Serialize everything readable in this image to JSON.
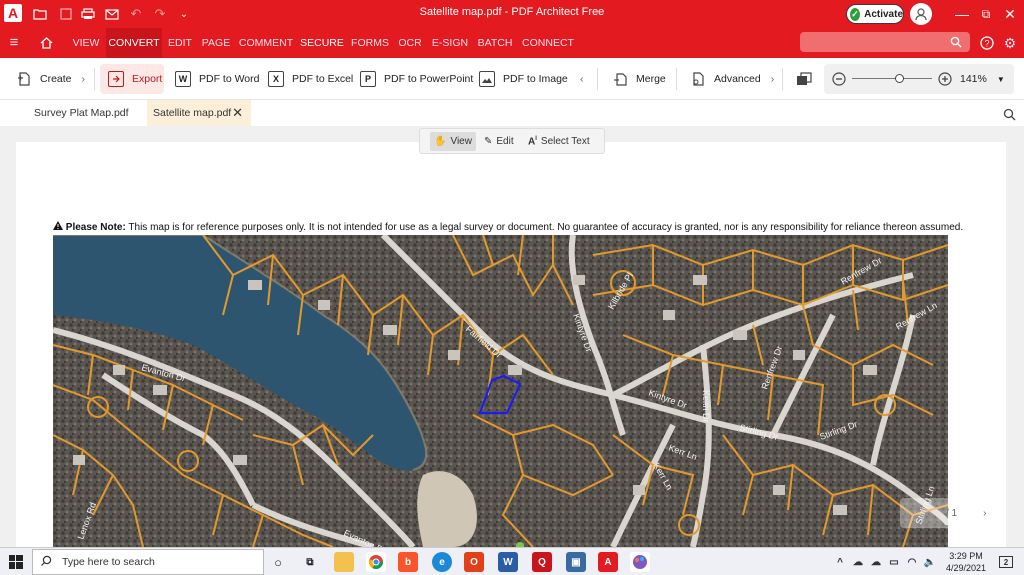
{
  "window": {
    "title": "Satellite map.pdf  -  PDF Architect Free",
    "activate_label": "Activate",
    "app_logo": "A"
  },
  "menu": {
    "tabs": [
      "VIEW",
      "CONVERT",
      "EDIT",
      "PAGE",
      "COMMENT",
      "SECURE",
      "FORMS",
      "OCR",
      "E-SIGN",
      "BATCH",
      "CONNECT"
    ],
    "active": "CONVERT"
  },
  "toolbar": {
    "create": "Create",
    "export": "Export",
    "pdf_to_word": "PDF to Word",
    "pdf_to_excel": "PDF to Excel",
    "pdf_to_powerpoint": "PDF to PowerPoint",
    "pdf_to_image": "PDF to Image",
    "merge": "Merge",
    "advanced": "Advanced",
    "zoom": "141%",
    "zoom_fraction": 0.6
  },
  "documents": {
    "tabs": [
      "Survey Plat Map.pdf",
      "Satellite map.pdf"
    ],
    "active": "Satellite map.pdf"
  },
  "modes": {
    "view": "View",
    "edit": "Edit",
    "select_text": "Select Text"
  },
  "page": {
    "note_bold": "Please Note:",
    "note_text": " This map is for reference purposes only. It is not intended for use as a legal survey or document. No guarantee of accuracy is granted, nor is any responsibility for reliance thereon assumed.",
    "page_nav": "/ 1"
  },
  "map": {
    "street_labels": [
      "Evanton Dr",
      "Evanton Dr",
      "Kintyre Dr",
      "Kilbride Pl",
      "Kintyre Dr",
      "Kerr Ln",
      "Stirling Dr",
      "Stirling Dr",
      "Stirling Ln",
      "Renfrew Dr",
      "Renfrew Ln",
      "Renfrew Dr",
      "Keith Dr",
      "Fairfield Dr",
      "Kerr Ln",
      "Lenox Rd"
    ],
    "parcel_color": "#e39a2c",
    "highlight_color": "#1a1aff",
    "water_color": "#2d5570"
  },
  "taskbar": {
    "search_placeholder": "Type here to search",
    "time": "3:29 PM",
    "date": "4/29/2021",
    "notifications": "2"
  }
}
